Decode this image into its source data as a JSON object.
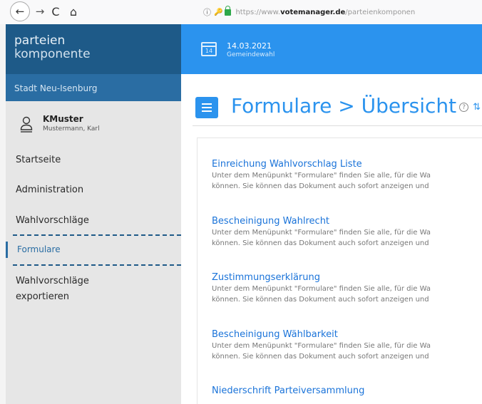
{
  "browser": {
    "back_glyph": "←",
    "forward_glyph": "→",
    "reload_glyph": "C",
    "home_glyph": "⌂",
    "info_glyph": "ⓘ",
    "key_glyph": "🔑",
    "url_scheme": "https://www.",
    "url_host": "votemanager.de",
    "url_path": "/parteienkomponen"
  },
  "sidebar": {
    "brand_line1": "parteien",
    "brand_line2": "komponente",
    "city": "Stadt Neu-Isenburg",
    "user_name": "KMuster",
    "user_full_name": "Mustermann, Karl",
    "items": [
      {
        "label": "Startseite"
      },
      {
        "label": "Administration"
      },
      {
        "label": "Wahlvorschläge"
      },
      {
        "label": "Formulare"
      },
      {
        "label": "Wahlvorschläge"
      },
      {
        "label": "exportieren"
      }
    ]
  },
  "topband": {
    "calendar_day": "14",
    "date": "14.03.2021",
    "election": "Gemeindewahl"
  },
  "main": {
    "title": "Formulare > Übersicht",
    "help_glyph": "?",
    "help_extra": "⇅",
    "forms": [
      {
        "title": "Einreichung Wahlvorschlag Liste",
        "desc1": "Unter dem Menüpunkt \"Formulare\" finden Sie alle, für die Wa",
        "desc2": "können. Sie können das Dokument auch sofort anzeigen und"
      },
      {
        "title": "Bescheinigung Wahlrecht",
        "desc1": "Unter dem Menüpunkt \"Formulare\" finden Sie alle, für die Wa",
        "desc2": "können. Sie können das Dokument auch sofort anzeigen und"
      },
      {
        "title": "Zustimmungserklärung",
        "desc1": "Unter dem Menüpunkt \"Formulare\" finden Sie alle, für die Wa",
        "desc2": "können. Sie können das Dokument auch sofort anzeigen und"
      },
      {
        "title": "Bescheinigung Wählbarkeit",
        "desc1": "Unter dem Menüpunkt \"Formulare\" finden Sie alle, für die Wa",
        "desc2": "können. Sie können das Dokument auch sofort anzeigen und"
      },
      {
        "title": "Niederschrift Parteiversammlung"
      }
    ]
  },
  "colors": {
    "brand_dark": "#1e5a88",
    "brand_mid": "#2a6da3",
    "accent_blue": "#2b93ee",
    "link_blue": "#1a73d9",
    "lock_green": "#2ea84a",
    "sidebar_bg": "#e6e6e6"
  }
}
